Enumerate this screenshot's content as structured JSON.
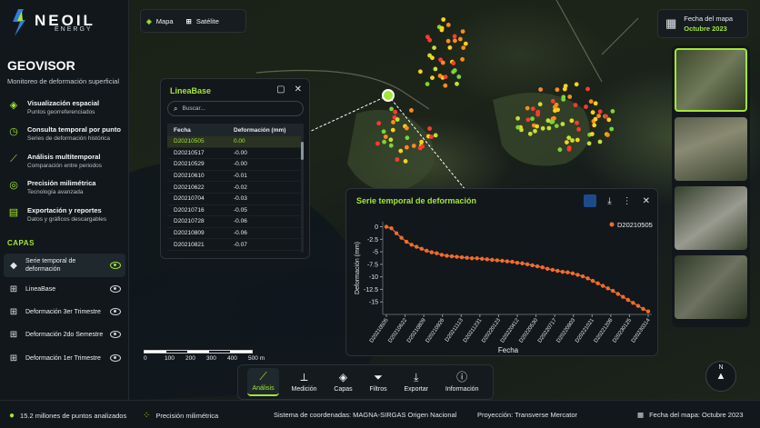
{
  "brand": {
    "name": "NEOIL",
    "sub": "ENERGY",
    "colors": {
      "accent": "#a3e635",
      "panel": "#12171b",
      "series": "#f26b2a"
    }
  },
  "app": {
    "title": "GEOVISOR",
    "subtitle": "Monitoreo de deformación superficial"
  },
  "features": [
    {
      "icon": "target-icon",
      "title": "Visualización espacial",
      "desc": "Puntos georreferenciados"
    },
    {
      "icon": "clock-icon",
      "title": "Consulta temporal por punto",
      "desc": "Series de deformación histórica"
    },
    {
      "icon": "trend-icon",
      "title": "Análisis multitemporal",
      "desc": "Comparación entre periodos"
    },
    {
      "icon": "crosshair-icon",
      "title": "Precisión milimétrica",
      "desc": "Tecnología avanzada"
    },
    {
      "icon": "document-icon",
      "title": "Exportación y reportes",
      "desc": "Datos y gráficos descargables"
    }
  ],
  "layers_title": "CAPAS",
  "layers": [
    {
      "label": "Serie temporal de deformación",
      "active": true
    },
    {
      "label": "LineaBase",
      "active": false
    },
    {
      "label": "Deformación 3er Trimestre",
      "active": false
    },
    {
      "label": "Deformación 2do Semestre",
      "active": false
    },
    {
      "label": "Deformación 1er Trimestre",
      "active": false
    }
  ],
  "basemap": {
    "options": [
      "Mapa",
      "Satélite"
    ]
  },
  "map_date": {
    "label": "Fecha del mapa",
    "value": "Octubre 2023"
  },
  "lineabase": {
    "title": "LineaBase",
    "search_placeholder": "Buscar...",
    "columns": [
      "Fecha",
      "Deformación (mm)"
    ],
    "rows": [
      [
        "D20210505",
        "0.00"
      ],
      [
        "D20210517",
        "-0.00"
      ],
      [
        "D20210529",
        "-0.00"
      ],
      [
        "D20210610",
        "-0.01"
      ],
      [
        "D20210622",
        "-0.02"
      ],
      [
        "D20210704",
        "-0.03"
      ],
      [
        "D20210716",
        "-0.05"
      ],
      [
        "D20210728",
        "-0.06"
      ],
      [
        "D20210809",
        "-0.06"
      ],
      [
        "D20210821",
        "-0.07"
      ]
    ]
  },
  "timeseries": {
    "title": "Serie temporal de deformación"
  },
  "chart_data": {
    "type": "line",
    "title": "",
    "xlabel": "Fecha",
    "ylabel": "Deformación (mm)",
    "ylim": [
      -17.5,
      1
    ],
    "yticks": [
      0,
      -2.5,
      -5,
      -7.5,
      -10,
      -12.5,
      -15
    ],
    "legend": "top-right",
    "xticks": [
      "D20210505",
      "D20210622",
      "D20210809",
      "D20210926",
      "D20211113",
      "D20211231",
      "D20220123",
      "D20220412",
      "D20220530",
      "D20220717",
      "D20220903",
      "D20221021",
      "D20221208",
      "D20230125",
      "D20230314"
    ],
    "series": [
      {
        "name": "D20210505",
        "values": [
          0,
          -0.3,
          -1.3,
          -2.2,
          -3.0,
          -3.6,
          -4.0,
          -4.4,
          -4.8,
          -5.1,
          -5.3,
          -5.6,
          -5.8,
          -5.9,
          -6.0,
          -6.1,
          -6.2,
          -6.3,
          -6.3,
          -6.4,
          -6.5,
          -6.6,
          -6.7,
          -6.8,
          -6.9,
          -7.0,
          -7.2,
          -7.3,
          -7.5,
          -7.7,
          -7.9,
          -8.1,
          -8.4,
          -8.6,
          -8.8,
          -9.0,
          -9.1,
          -9.3,
          -9.6,
          -9.9,
          -10.3,
          -10.8,
          -11.3,
          -11.8,
          -12.3,
          -12.8,
          -13.4,
          -14.0,
          -14.6,
          -15.2,
          -15.8,
          -16.4,
          -16.9
        ]
      }
    ]
  },
  "scale": {
    "labels": [
      "0",
      "100",
      "200",
      "300",
      "400",
      "500 m"
    ]
  },
  "toolbar": [
    "Análisis",
    "Medición",
    "Capas",
    "Filtros",
    "Exportar",
    "Información"
  ],
  "compass": "N",
  "status": {
    "points": "15.2 millones de puntos analizados",
    "precision": "Precisión milimétrica",
    "crs": "Sistema de coordenadas: MAGNA-SIRGAS Origen Nacional",
    "projection": "Proyección: Transverse Mercator",
    "map_date": "Fecha del mapa: Octubre 2023"
  }
}
